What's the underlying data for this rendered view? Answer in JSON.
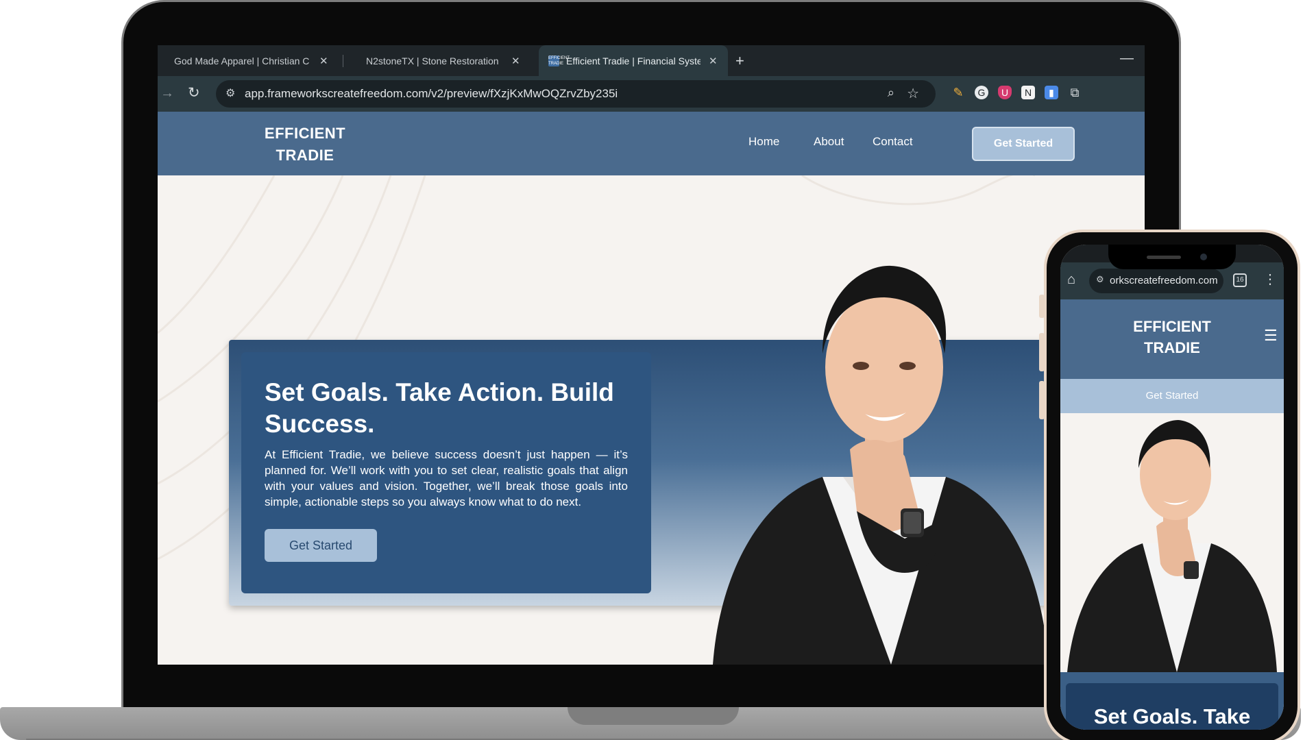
{
  "browser": {
    "tabs": [
      {
        "title": "God Made Apparel | Christian C",
        "active": false
      },
      {
        "title": "N2stoneTX | Stone Restoration",
        "active": false
      },
      {
        "title": "Efficient Tradie | Financial Syste",
        "active": true
      }
    ],
    "favicon_text": "EFFICIENT TRADIE",
    "new_tab": "+",
    "close_glyph": "✕",
    "url": "app.frameworkscreatefreedom.com/v2/preview/fXzjKxMwOQZrvZby235i"
  },
  "site": {
    "logo_line1": "EFFICIENT",
    "logo_line2": "TRADIE",
    "nav": [
      "Home",
      "About",
      "Contact"
    ],
    "cta": "Get Started",
    "hero": {
      "title": "Set Goals. Take Action. Build Success.",
      "body": "At Efficient Tradie, we believe success doesn’t just happen — it’s planned for. We’ll work with you to set clear, realistic goals that align with your values and vision. Together, we’ll break those goals into simple, actionable steps so you always know what to do next.",
      "button": "Get Started"
    }
  },
  "phone": {
    "url": "orkscreatefreedom.com",
    "tab_count": "16",
    "logo_line1": "EFFICIENT",
    "logo_line2": "TRADIE",
    "cta": "Get Started",
    "hero_title": "Set Goals. Take"
  },
  "colors": {
    "nav_blue": "#4a6a8d",
    "card_blue": "#2e5580",
    "button_light": "#a8c0d9",
    "page_bg": "#f6f3f0",
    "browser_dark": "#1f2529"
  }
}
